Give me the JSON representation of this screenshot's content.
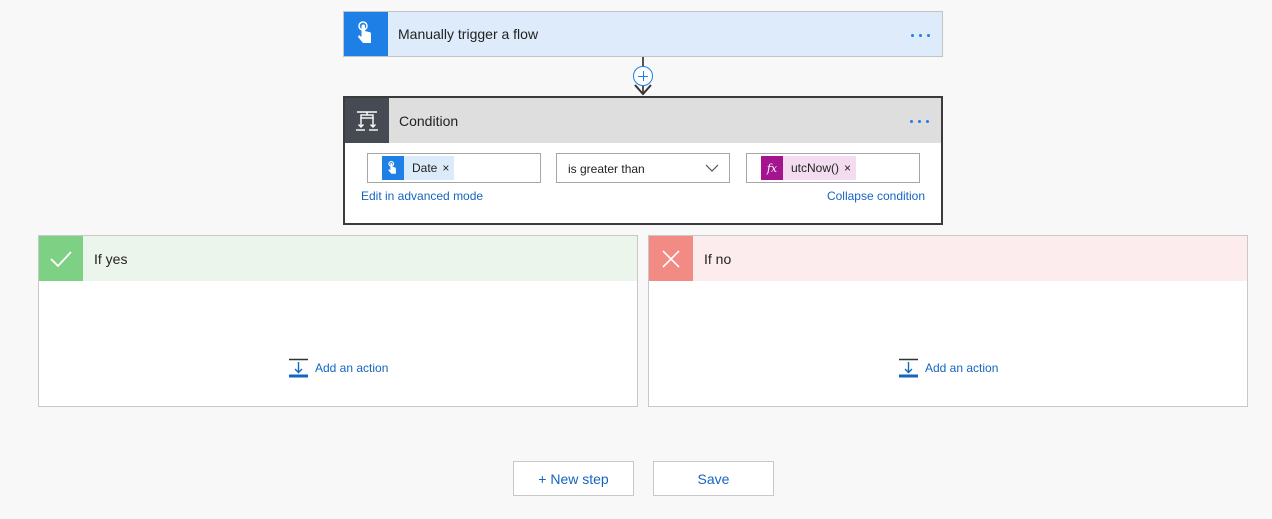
{
  "trigger": {
    "title": "Manually trigger a flow",
    "icon": "touch-icon",
    "color": "#1e7fe6"
  },
  "condition": {
    "title": "Condition",
    "icon": "condition-icon",
    "left_token": {
      "label": "Date",
      "icon": "touch-icon",
      "remove": "×"
    },
    "operator": "is greater than",
    "right_token": {
      "label": "utcNow()",
      "icon_text": "fx",
      "remove": "×"
    },
    "advanced_link": "Edit in advanced mode",
    "collapse_link": "Collapse condition"
  },
  "branches": {
    "yes": {
      "title": "If yes",
      "add_action": "Add an action",
      "color": "#7ed184"
    },
    "no": {
      "title": "If no",
      "add_action": "Add an action",
      "color": "#f28b84"
    }
  },
  "footer": {
    "new_step": "+ New step",
    "save": "Save"
  },
  "colors": {
    "accent": "#1e7fe6",
    "link": "#1565c0"
  }
}
